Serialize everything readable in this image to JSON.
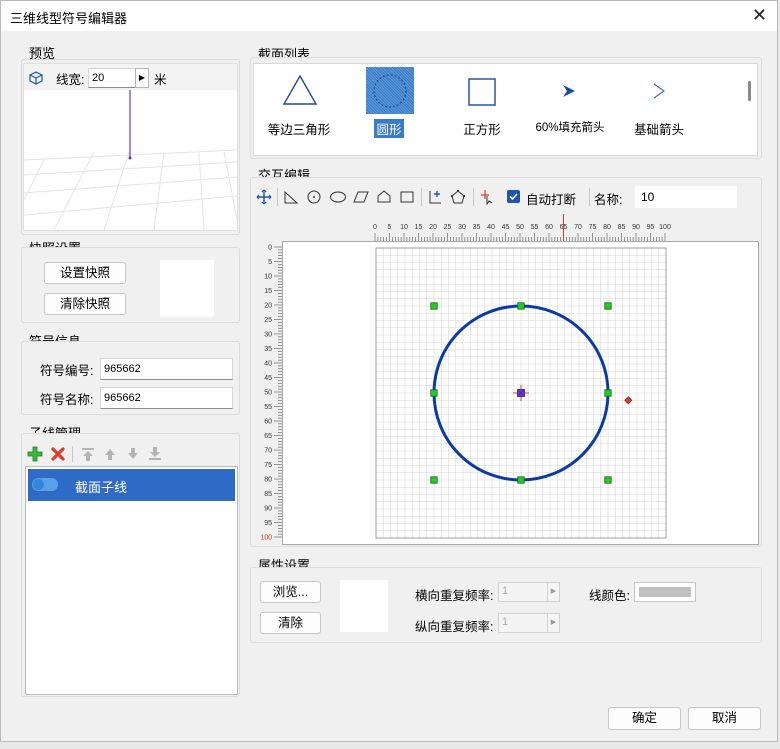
{
  "window": {
    "title": "三维线型符号编辑器"
  },
  "preview": {
    "title": "预览",
    "linewidth_label": "线宽:",
    "linewidth_value": "20",
    "unit": "米"
  },
  "snapshot": {
    "title": "快照设置",
    "set_btn": "设置快照",
    "clear_btn": "清除快照"
  },
  "symbol_info": {
    "title": "符号信息",
    "code_label": "符号编号:",
    "code_value": "965662",
    "name_label": "符号名称:",
    "name_value": "965662"
  },
  "subline": {
    "title": "子线管理",
    "items": [
      "截面子线"
    ]
  },
  "section_list": {
    "title": "截面列表",
    "shapes": [
      "等边三角形",
      "圆形",
      "正方形",
      "60%填充箭头",
      "基础箭头"
    ],
    "selected": 1
  },
  "interactive": {
    "title": "交互编辑",
    "auto_break_label": "自动打断",
    "auto_break_checked": true,
    "name_label": "名称:",
    "name_value": "10",
    "ruler_x": [
      "0",
      "5",
      "10",
      "15",
      "20",
      "25",
      "30",
      "35",
      "40",
      "45",
      "50",
      "55",
      "60",
      "65",
      "70",
      "75",
      "80",
      "85",
      "90",
      "95",
      "100"
    ],
    "ruler_y": [
      "0",
      "5",
      "10",
      "15",
      "20",
      "25",
      "30",
      "35",
      "40",
      "45",
      "50",
      "55",
      "60",
      "65",
      "70",
      "75",
      "80",
      "85",
      "90",
      "95",
      "100"
    ]
  },
  "attributes": {
    "title": "属性设置",
    "browse_btn": "浏览...",
    "clear_btn": "清除",
    "h_repeat_label": "横向重复频率:",
    "h_repeat_value": "1",
    "v_repeat_label": "纵向重复频率:",
    "v_repeat_value": "1",
    "line_color_label": "线颜色:"
  },
  "footer": {
    "ok": "确定",
    "cancel": "取消"
  },
  "colors": {
    "accent": "#2f6ac6",
    "circle": "#0a3aa8",
    "handle": "#22cc22"
  }
}
